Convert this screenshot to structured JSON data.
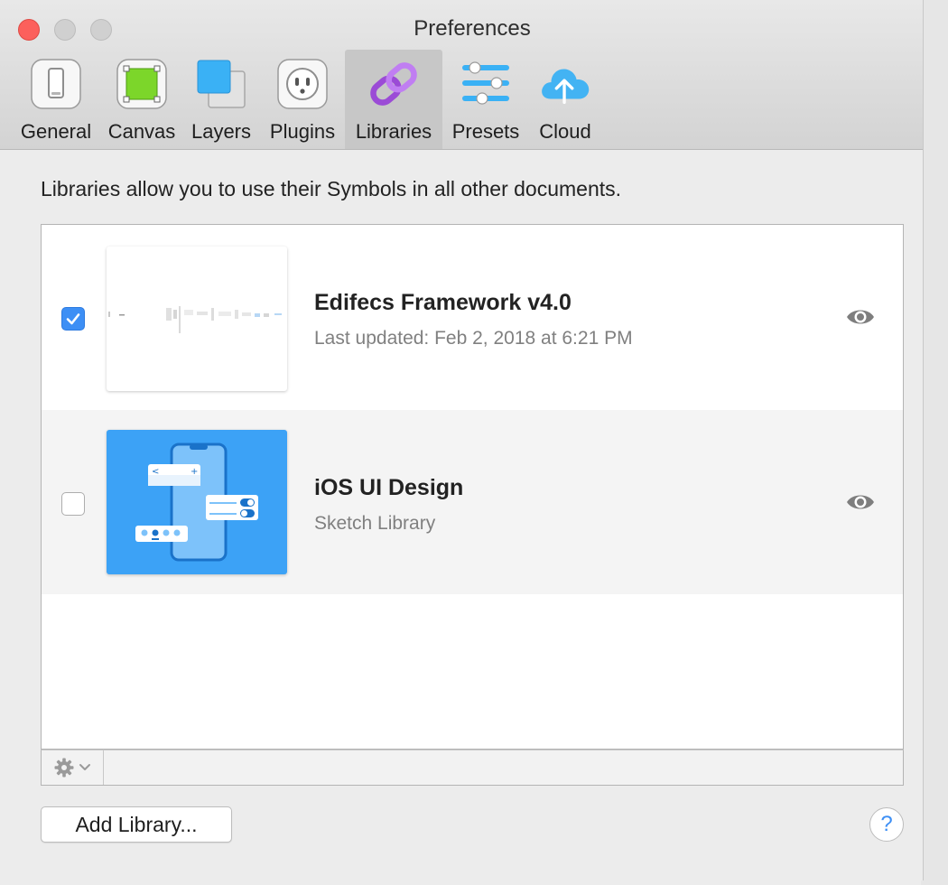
{
  "window": {
    "title": "Preferences"
  },
  "toolbar": {
    "tabs": [
      {
        "label": "General",
        "icon": "general-icon"
      },
      {
        "label": "Canvas",
        "icon": "canvas-icon"
      },
      {
        "label": "Layers",
        "icon": "layers-icon"
      },
      {
        "label": "Plugins",
        "icon": "plugins-icon"
      },
      {
        "label": "Libraries",
        "icon": "libraries-icon",
        "active": true
      },
      {
        "label": "Presets",
        "icon": "presets-icon"
      },
      {
        "label": "Cloud",
        "icon": "cloud-icon"
      }
    ]
  },
  "main": {
    "description": "Libraries allow you to use their Symbols in all other documents.",
    "libraries": [
      {
        "title": "Edifecs Framework v4.0",
        "subtitle": "Last updated: Feb 2, 2018 at 6:21 PM",
        "enabled": true
      },
      {
        "title": "iOS UI Design",
        "subtitle": "Sketch Library",
        "enabled": false
      }
    ],
    "add_library_label": "Add Library...",
    "help_label": "?"
  },
  "colors": {
    "accent": "#3d8ff5",
    "close": "#fc605c",
    "library_thumb": "#3ca2f6"
  }
}
